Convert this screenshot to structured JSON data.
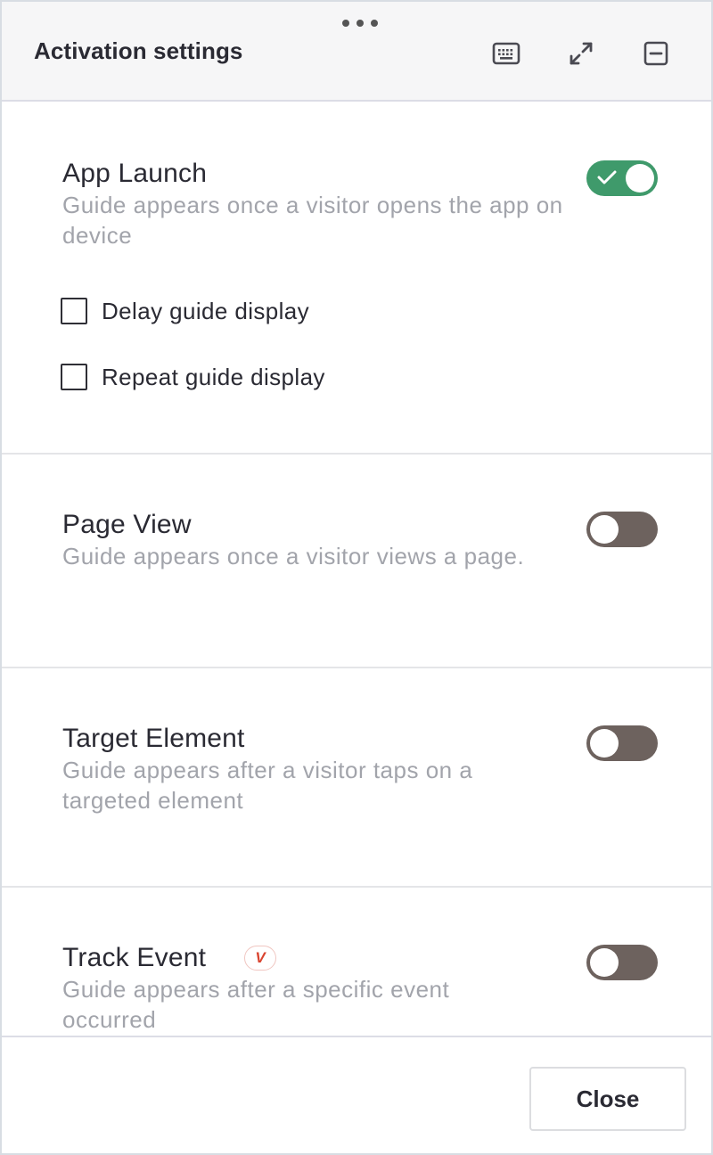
{
  "header": {
    "title": "Activation settings",
    "icons": [
      "drag-handle",
      "keyboard-icon",
      "expand-icon",
      "minimize-icon"
    ]
  },
  "sections": [
    {
      "title": "App Launch",
      "description": "Guide appears once a visitor opens the app on device",
      "toggle_on": true,
      "options": [
        {
          "label": "Delay guide display",
          "checked": false
        },
        {
          "label": "Repeat guide display",
          "checked": false
        }
      ]
    },
    {
      "title": "Page View",
      "description": "Guide appears once a visitor views a page.",
      "toggle_on": false
    },
    {
      "title": "Target Element",
      "description": "Guide appears after a visitor taps on a targeted element",
      "toggle_on": false
    },
    {
      "title": "Track Event",
      "badge": "V",
      "description": "Guide appears after a specific event occurred",
      "toggle_on": false
    }
  ],
  "footer": {
    "close_label": "Close"
  },
  "colors": {
    "toggle_on": "#3f9a6b",
    "toggle_off": "#6d625e",
    "badge_text": "#d9442f",
    "description": "#a2a4ab"
  }
}
